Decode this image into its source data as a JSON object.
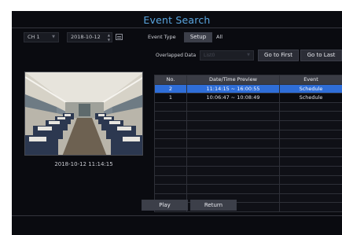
{
  "header": {
    "title": "Event Search"
  },
  "filters": {
    "channel": "CH 1",
    "date": "2018-10-12",
    "event_type_label": "Event Type",
    "setup_label": "Setup",
    "event_type_value": "All"
  },
  "overlapped": {
    "label": "Overlapped Data",
    "value": "List0",
    "go_first_label": "Go to First",
    "go_last_label": "Go to Last"
  },
  "preview": {
    "timestamp": "2018-10-12 11:14:15"
  },
  "table": {
    "columns": [
      "No.",
      "Date/Time Preview",
      "Event"
    ],
    "rows": [
      {
        "no": "2",
        "time": "11:14:15 ~ 16:00:55",
        "event": "Schedule"
      },
      {
        "no": "1",
        "time": "10:06:47 ~ 10:08:49",
        "event": "Schedule"
      }
    ]
  },
  "footer": {
    "play_label": "Play",
    "return_label": "Return"
  }
}
